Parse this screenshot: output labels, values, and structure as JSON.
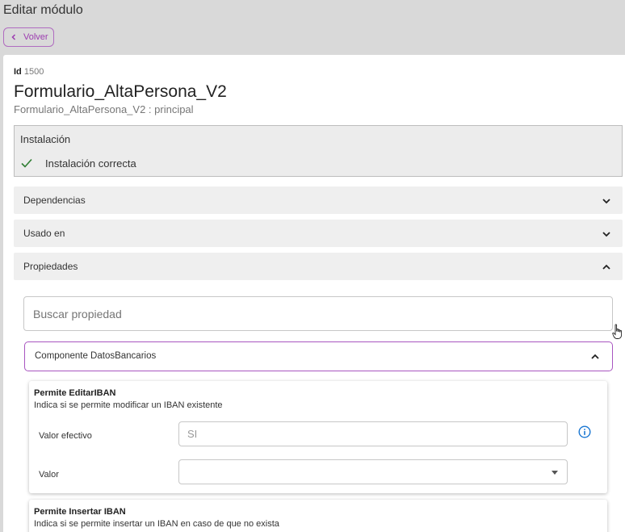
{
  "header": {
    "title": "Editar módulo",
    "back_label": "Volver"
  },
  "module": {
    "id_label": "Id",
    "id_value": "1500",
    "name": "Formulario_AltaPersona_V2",
    "subtitle": "Formulario_AltaPersona_V2 : principal"
  },
  "installation": {
    "title": "Instalación",
    "status": "Instalación correcta"
  },
  "accordions": [
    {
      "label": "Dependencias",
      "expanded": false
    },
    {
      "label": "Usado en",
      "expanded": false
    },
    {
      "label": "Propiedades",
      "expanded": true
    }
  ],
  "properties": {
    "search_placeholder": "Buscar propiedad",
    "component_label": "Componente DatosBancarios",
    "items": [
      {
        "title": "Permite EditarIBAN",
        "description": "Indica si se permite modificar un IBAN existente",
        "effective_label": "Valor efectivo",
        "effective_value": "SI",
        "value_label": "Valor",
        "value": ""
      },
      {
        "title": "Permite Insertar IBAN",
        "description": "Indica si se permite insertar un IBAN en caso de que no exista"
      }
    ]
  },
  "colors": {
    "accent": "#9c3cb0",
    "success": "#2e7d32",
    "info": "#1976d2"
  }
}
